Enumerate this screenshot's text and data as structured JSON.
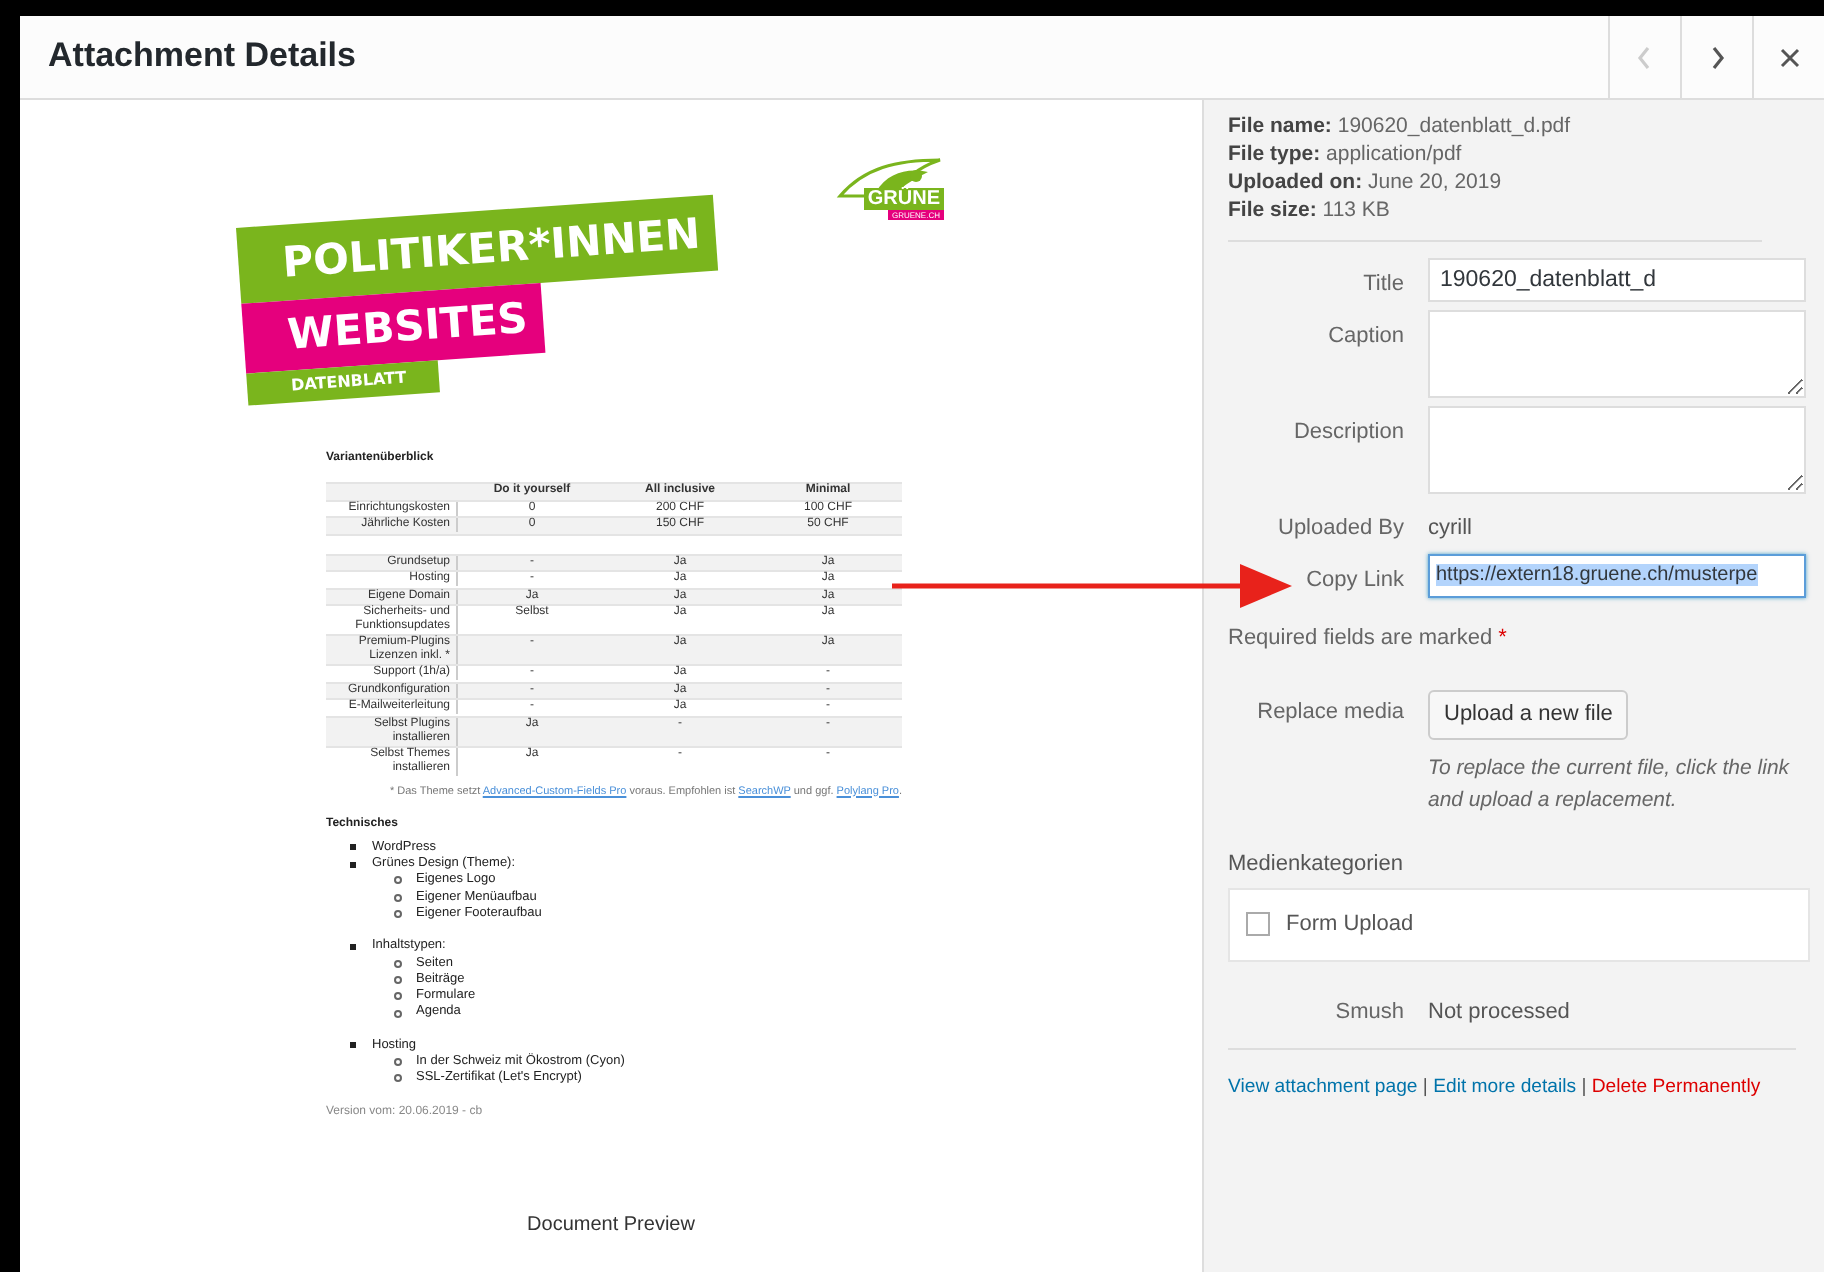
{
  "window": {
    "title": "Attachment Details"
  },
  "header_buttons": [
    {
      "kind": "prev",
      "disabled": true
    },
    {
      "kind": "next",
      "disabled": false
    },
    {
      "kind": "close",
      "disabled": false
    }
  ],
  "document": {
    "logo": {
      "text": "GRÜNE",
      "subtext": "GRUENE.CH"
    },
    "banner": [
      {
        "text": "POLITIKER*INNEN",
        "color": "#7ab51d"
      },
      {
        "text": "WEBSITES",
        "color": "#e5007d"
      },
      {
        "text": "DATENBLATT",
        "color": "#7ab51d"
      }
    ],
    "table_title": "Variantenüberblick",
    "columns": [
      "Do it yourself",
      "All inclusive",
      "Minimal"
    ],
    "rows": [
      {
        "kind": "data",
        "label": "Einrichtungskosten",
        "cells": [
          "0",
          "200 CHF",
          "100 CHF"
        ]
      },
      {
        "kind": "data",
        "label": "Jährliche Kosten",
        "cells": [
          "0",
          "150 CHF",
          "50 CHF"
        ]
      },
      {
        "kind": "spacer"
      },
      {
        "kind": "data",
        "label": "Grundsetup",
        "cells": [
          "-",
          "Ja",
          "Ja"
        ]
      },
      {
        "kind": "data",
        "label": "Hosting",
        "cells": [
          "-",
          "Ja",
          "Ja"
        ]
      },
      {
        "kind": "data",
        "label": "Eigene Domain",
        "cells": [
          "Ja",
          "Ja",
          "Ja"
        ]
      },
      {
        "kind": "data",
        "label": "Sicherheits- und Funktionsupdates",
        "cells": [
          "Selbst",
          "Ja",
          "Ja"
        ]
      },
      {
        "kind": "data",
        "label": "Premium-Plugins Lizenzen inkl. *",
        "cells": [
          "-",
          "Ja",
          "Ja"
        ]
      },
      {
        "kind": "data",
        "label": "Support (1h/a)",
        "cells": [
          "-",
          "Ja",
          "-"
        ]
      },
      {
        "kind": "data",
        "label": "Grundkonfiguration",
        "cells": [
          "-",
          "Ja",
          "-"
        ]
      },
      {
        "kind": "data",
        "label": "E-Mailweiterleitung",
        "cells": [
          "-",
          "Ja",
          "-"
        ]
      },
      {
        "kind": "data",
        "label": "Selbst Plugins installieren",
        "cells": [
          "Ja",
          "-",
          "-"
        ]
      },
      {
        "kind": "data",
        "label": "Selbst Themes installieren",
        "cells": [
          "Ja",
          "-",
          "-"
        ]
      }
    ],
    "footnote": [
      {
        "kind": "text",
        "text": "* Das Theme setzt "
      },
      {
        "kind": "link",
        "text": "Advanced-Custom-Fields Pro"
      },
      {
        "kind": "text",
        "text": " voraus. Empfohlen ist "
      },
      {
        "kind": "link",
        "text": "SearchWP"
      },
      {
        "kind": "text",
        "text": " und ggf. "
      },
      {
        "kind": "link",
        "text": "Polylang Pro"
      },
      {
        "kind": "text",
        "text": "."
      }
    ],
    "section_title": "Technisches",
    "list": [
      {
        "text": "WordPress"
      },
      {
        "text": "Grünes Design (Theme):",
        "children": [
          {
            "text": "Eigenes Logo"
          },
          {
            "text": "Eigener Menüaufbau"
          },
          {
            "text": "Eigener Footeraufbau"
          }
        ]
      },
      {
        "text": "Inhaltstypen:",
        "children": [
          {
            "text": "Seiten"
          },
          {
            "text": "Beiträge"
          },
          {
            "text": "Formulare"
          },
          {
            "text": "Agenda"
          }
        ]
      },
      {
        "text": "Hosting",
        "children": [
          {
            "text": "In der Schweiz mit Ökostrom (Cyon)"
          },
          {
            "text": "SSL-Zertifikat (Let's Encrypt)"
          }
        ]
      }
    ],
    "version": "Version vom: 20.06.2019 - cb"
  },
  "preview_caption": "Document Preview",
  "file_info": [
    {
      "label": "File name:",
      "value": "190620_datenblatt_d.pdf"
    },
    {
      "label": "File type:",
      "value": "application/pdf"
    },
    {
      "label": "Uploaded on:",
      "value": "June 20, 2019"
    },
    {
      "label": "File size:",
      "value": "113 KB"
    }
  ],
  "fields": [
    {
      "kind": "input",
      "label": "Title",
      "value": "190620_datenblatt_d",
      "focused": false
    },
    {
      "kind": "textarea",
      "label": "Caption"
    },
    {
      "kind": "textarea",
      "label": "Description"
    },
    {
      "kind": "text",
      "label": "Uploaded By",
      "value": "cyrill"
    },
    {
      "kind": "input",
      "label": "Copy Link",
      "value": "https://extern18.gruene.ch/musterpe",
      "focused": true
    }
  ],
  "required_note": {
    "text": "Required fields are marked",
    "mark": "*"
  },
  "replace_media": {
    "label": "Replace media",
    "button": "Upload a new file",
    "help": "To replace the current file, click the link and upload a replacement."
  },
  "categories": {
    "title": "Medienkategorien",
    "items": [
      {
        "label": "Form Upload",
        "checked": false
      }
    ]
  },
  "smush": {
    "label": "Smush",
    "value": "Not processed"
  },
  "actions": {
    "separator": "|",
    "links": [
      {
        "kind": "link",
        "text": "View attachment page"
      },
      {
        "kind": "link",
        "text": "Edit more details"
      },
      {
        "kind": "danger",
        "text": "Delete Permanently"
      }
    ]
  }
}
